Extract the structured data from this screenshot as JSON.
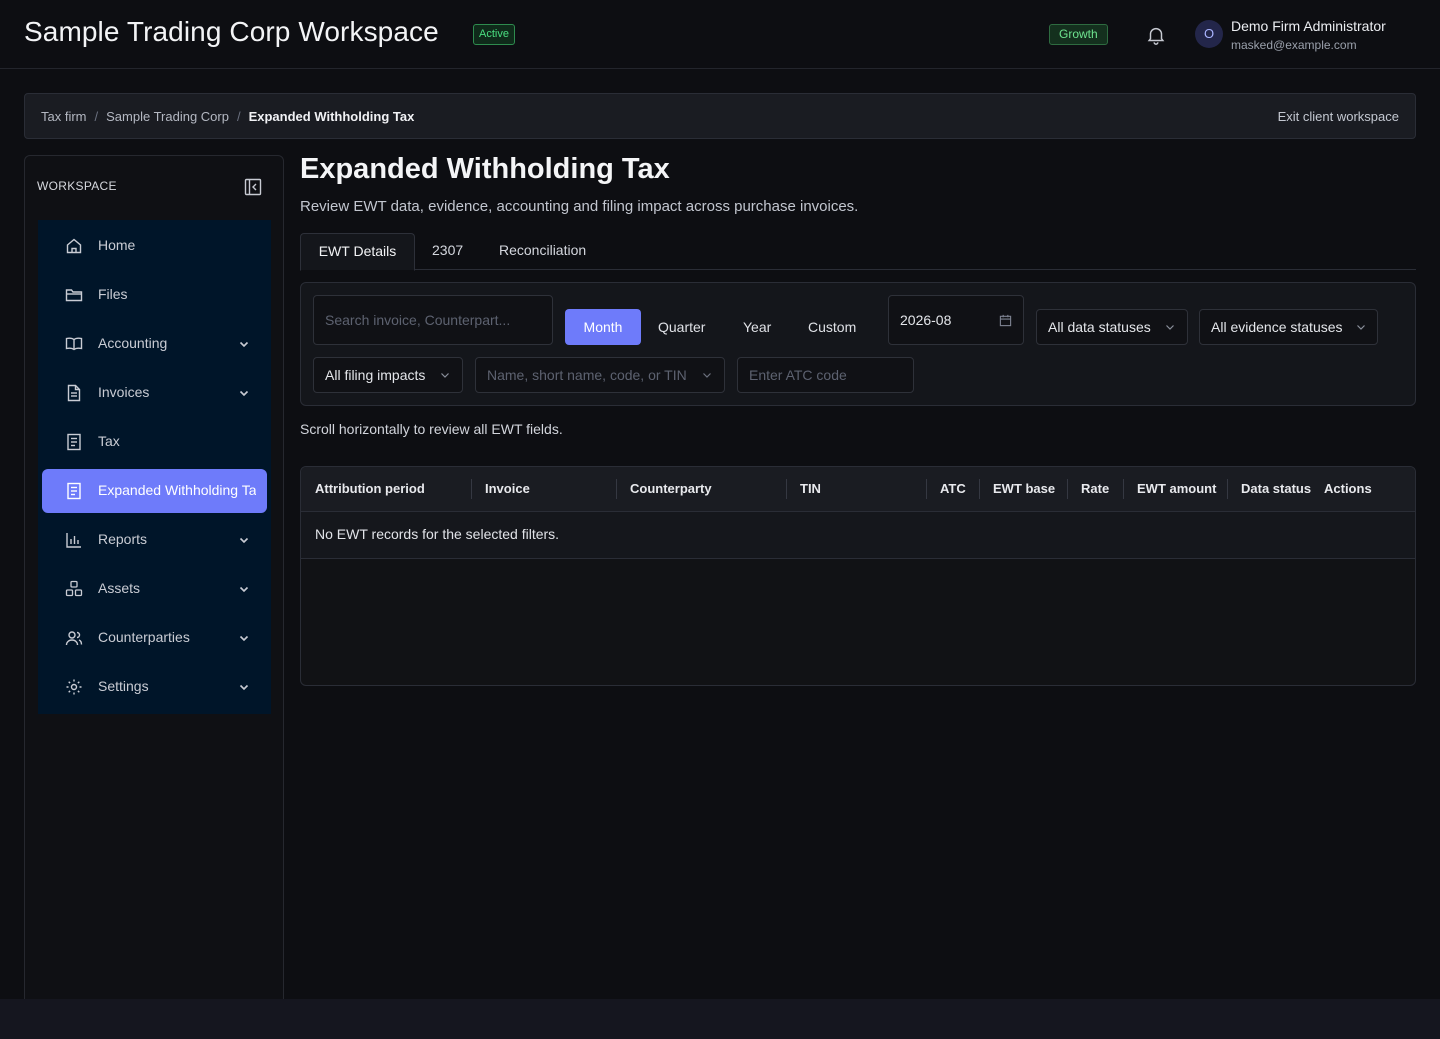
{
  "header": {
    "workspace_title": "Sample Trading Corp Workspace",
    "status_badge": "Active",
    "plan_badge": "Growth",
    "user": {
      "avatar_initial": "O",
      "name": "Demo Firm Administrator",
      "email": "masked@example.com"
    }
  },
  "breadcrumb": {
    "items": [
      "Tax firm",
      "Sample Trading Corp",
      "Expanded Withholding Tax"
    ],
    "separator": "/",
    "exit_label": "Exit client workspace"
  },
  "sidebar": {
    "heading": "WORKSPACE",
    "items": [
      {
        "label": "Home",
        "icon": "home-icon",
        "has_children": false
      },
      {
        "label": "Files",
        "icon": "folder-icon",
        "has_children": false
      },
      {
        "label": "Accounting",
        "icon": "book-icon",
        "has_children": true
      },
      {
        "label": "Invoices",
        "icon": "file-text-icon",
        "has_children": true
      },
      {
        "label": "Tax",
        "icon": "receipt-icon",
        "has_children": false
      },
      {
        "label": "Expanded Withholding Tax",
        "icon": "receipt-icon",
        "has_children": false,
        "active": true
      },
      {
        "label": "Reports",
        "icon": "bar-chart-icon",
        "has_children": true
      },
      {
        "label": "Assets",
        "icon": "cubes-icon",
        "has_children": true
      },
      {
        "label": "Counterparties",
        "icon": "users-icon",
        "has_children": true
      },
      {
        "label": "Settings",
        "icon": "gear-icon",
        "has_children": true
      }
    ]
  },
  "page": {
    "title": "Expanded Withholding Tax",
    "subtitle": "Review EWT data, evidence, accounting and filing impact across purchase invoices.",
    "tabs": [
      {
        "label": "EWT Details",
        "active": true
      },
      {
        "label": "2307",
        "active": false
      },
      {
        "label": "Reconciliation",
        "active": false
      }
    ]
  },
  "filters": {
    "search_placeholder": "Search invoice, Counterpart...",
    "period_modes": [
      "Month",
      "Quarter",
      "Year",
      "Custom"
    ],
    "period_selected": "Month",
    "period_value": "2026-08",
    "data_status": "All data statuses",
    "evidence_status": "All evidence statuses",
    "filing_impact": "All filing impacts",
    "counterparty_placeholder": "Name, short name, code, or TIN",
    "atc_placeholder": "Enter ATC code"
  },
  "table": {
    "hint": "Scroll horizontally to review all EWT fields.",
    "columns": [
      "Attribution period",
      "Invoice",
      "Counterparty",
      "TIN",
      "ATC",
      "EWT base",
      "Rate",
      "EWT amount",
      "Data status",
      "Actions"
    ],
    "empty_message": "No EWT records for the selected filters."
  },
  "colors": {
    "accent": "#6e7bfa",
    "menu_bg": "#001529",
    "success": "#4ade80"
  }
}
